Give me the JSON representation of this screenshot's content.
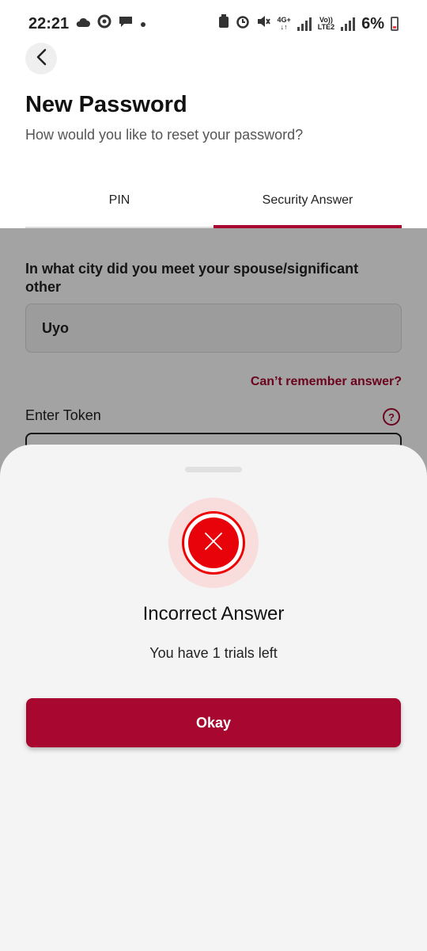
{
  "status_bar": {
    "time": "22:21",
    "network_top": "4G+",
    "network_bottom": "↓↑",
    "volte_top": "Vo))",
    "volte_bottom": "LTE2",
    "battery": "6%"
  },
  "header": {
    "title": "New Password",
    "subtitle": "How would you like to reset your password?"
  },
  "tabs": [
    {
      "label": "PIN",
      "active": false
    },
    {
      "label": "Security Answer",
      "active": true
    }
  ],
  "form": {
    "question": "In what city did you meet your spouse/significant other",
    "answer_value": "Uyo",
    "forgot_link": "Can’t remember answer?",
    "token_label": "Enter Token",
    "help_symbol": "?"
  },
  "dialog": {
    "icon": "error-x-icon",
    "title": "Incorrect Answer",
    "message": "You have 1 trials left",
    "button_label": "Okay"
  },
  "colors": {
    "accent": "#a8082f",
    "error": "#e8020a"
  }
}
